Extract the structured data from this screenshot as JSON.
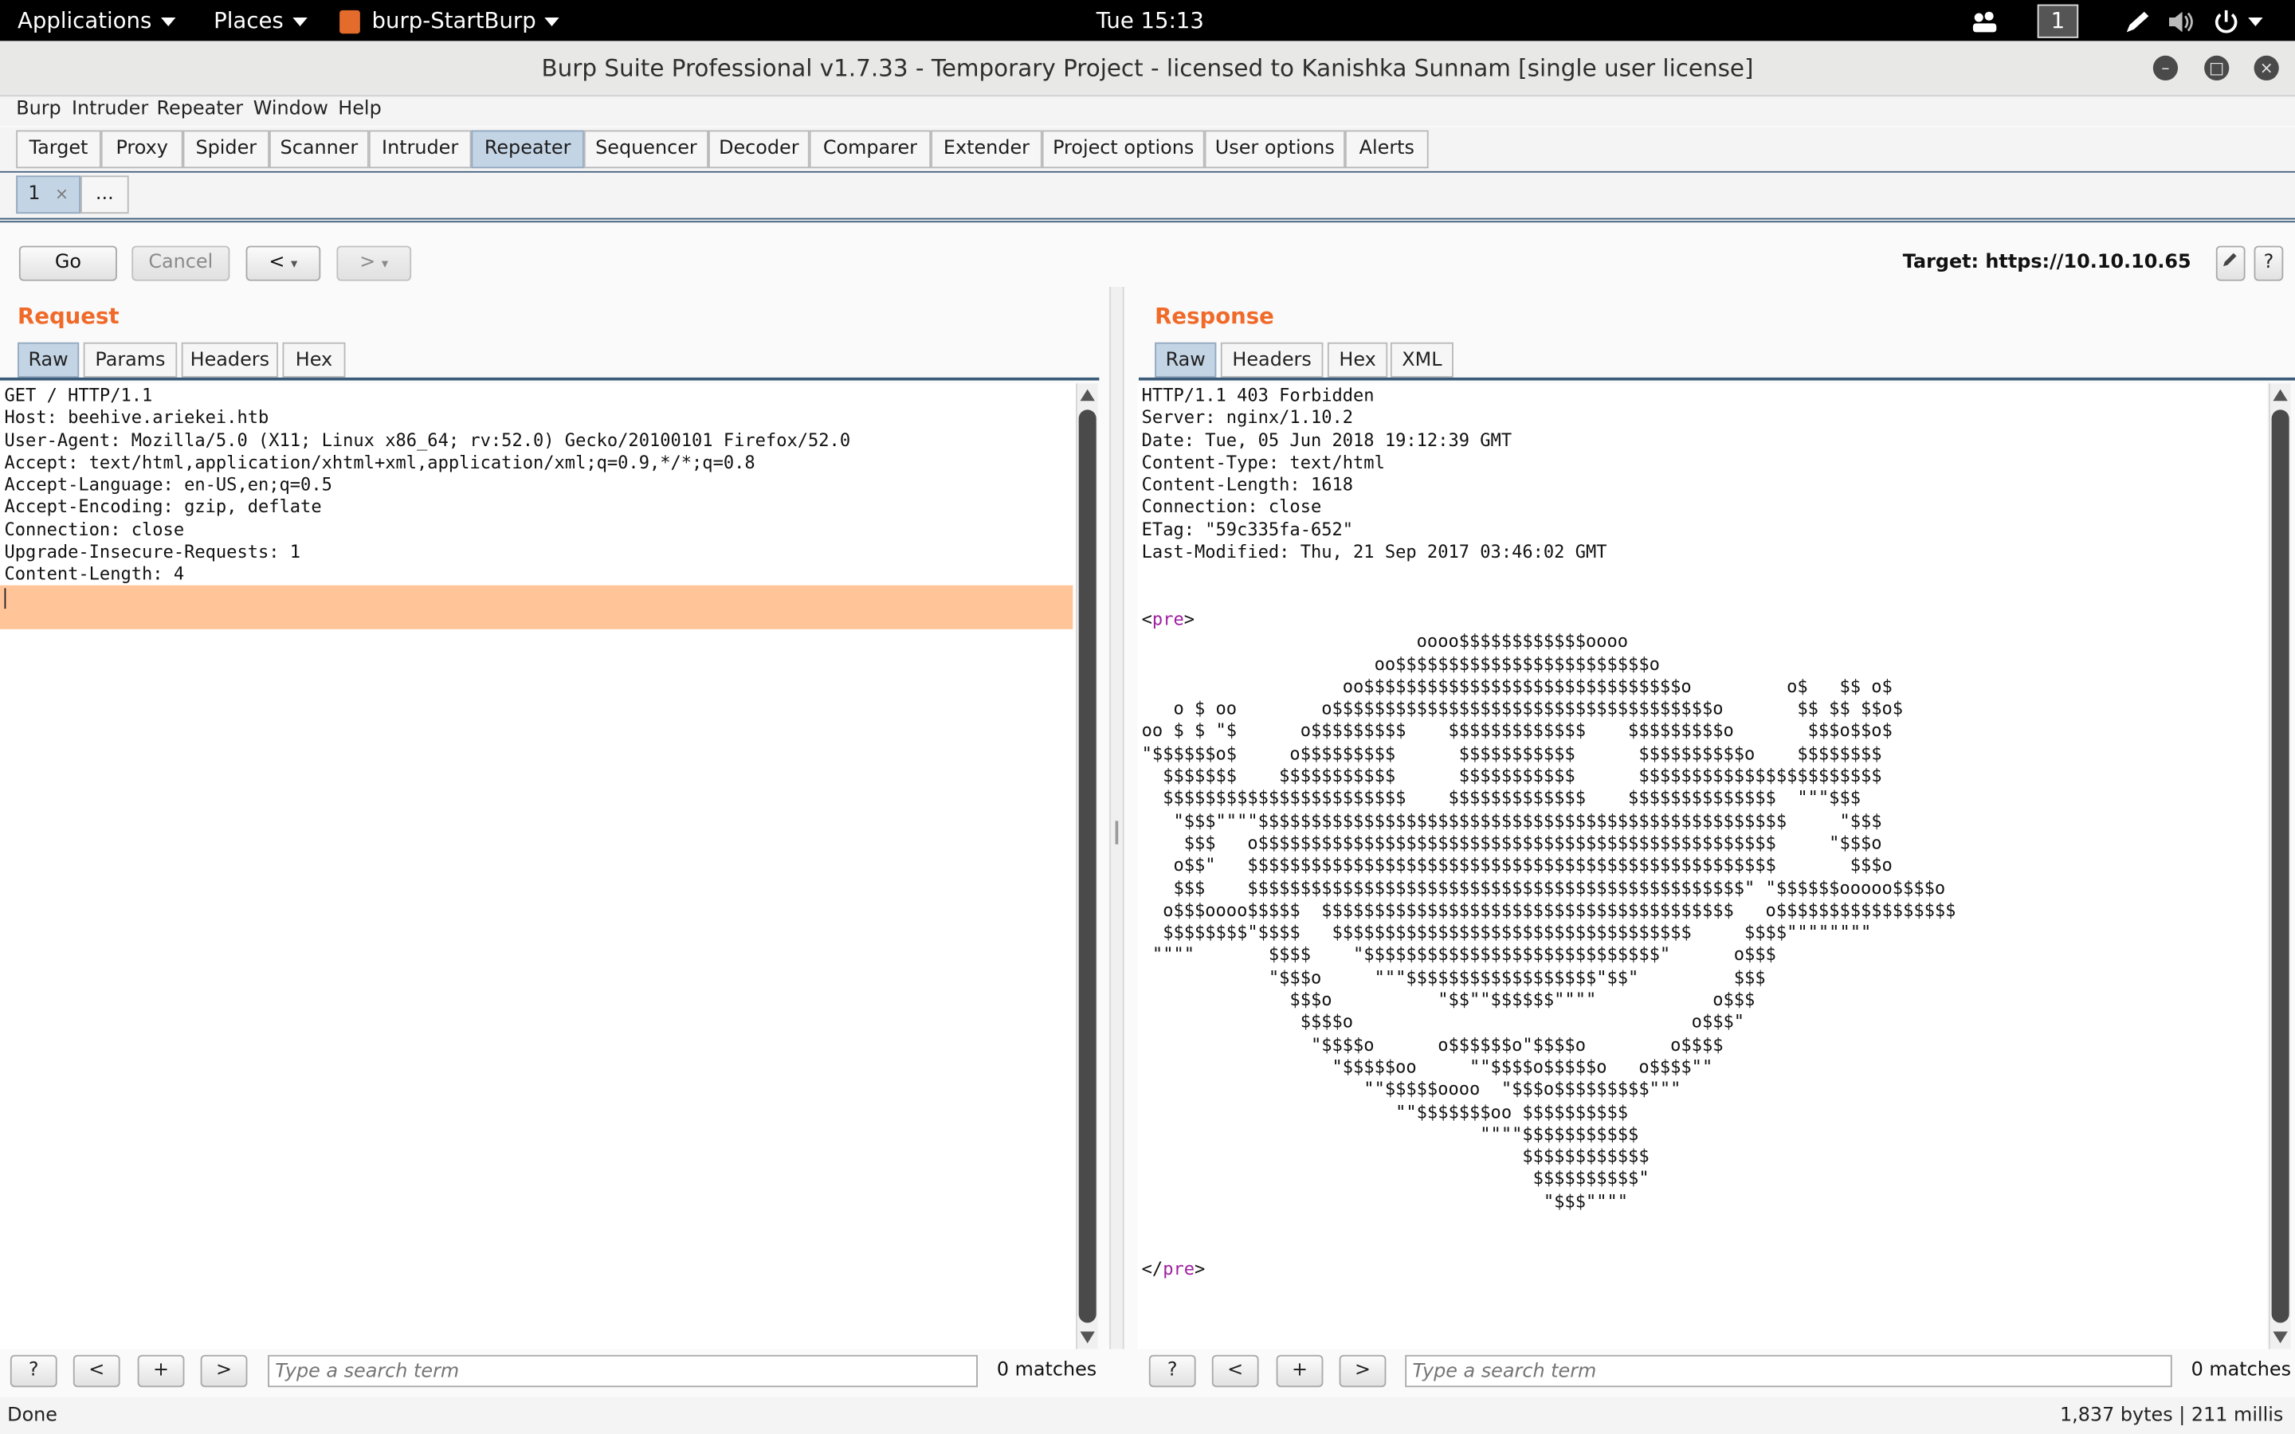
{
  "system_bar": {
    "applications": "Applications",
    "places": "Places",
    "app_name": "burp-StartBurp",
    "clock": "Tue 15:13",
    "workspace": "1"
  },
  "window": {
    "title": "Burp Suite Professional v1.7.33 - Temporary Project - licensed to Kanishka Sunnam [single user license]"
  },
  "menu": [
    "Burp",
    "Intruder",
    "Repeater",
    "Window",
    "Help"
  ],
  "main_tabs": [
    "Target",
    "Proxy",
    "Spider",
    "Scanner",
    "Intruder",
    "Repeater",
    "Sequencer",
    "Decoder",
    "Comparer",
    "Extender",
    "Project options",
    "User options",
    "Alerts"
  ],
  "active_main_tab": "Repeater",
  "repeater_tabs": {
    "tab1": "1",
    "tab1_close": "×",
    "more": "..."
  },
  "toolbar": {
    "go": "Go",
    "cancel": "Cancel",
    "back": "<",
    "forward": ">",
    "dropdown": "▾",
    "target_label": "Target: https://10.10.10.65",
    "help": "?"
  },
  "request": {
    "title": "Request",
    "tabs": [
      "Raw",
      "Params",
      "Headers",
      "Hex"
    ],
    "raw_text": "GET / HTTP/1.1\nHost: beehive.ariekei.htb\nUser-Agent: Mozilla/5.0 (X11; Linux x86_64; rv:52.0) Gecko/20100101 Firefox/52.0\nAccept: text/html,application/xhtml+xml,application/xml;q=0.9,*/*;q=0.8\nAccept-Language: en-US,en;q=0.5\nAccept-Encoding: gzip, deflate\nConnection: close\nUpgrade-Insecure-Requests: 1\nContent-Length: 4"
  },
  "response": {
    "title": "Response",
    "tabs": [
      "Raw",
      "Headers",
      "Hex",
      "XML"
    ],
    "headers_text": "HTTP/1.1 403 Forbidden\nServer: nginx/1.10.2\nDate: Tue, 05 Jun 2018 19:12:39 GMT\nContent-Type: text/html\nContent-Length: 1618\nConnection: close\nETag: \"59c335fa-652\"\nLast-Modified: Thu, 21 Sep 2017 03:46:02 GMT",
    "pre_open_lt": "<",
    "pre_tag": "pre",
    "pre_open_gt": ">",
    "ascii_art": "                          oooo$$$$$$$$$$$$oooo\n                      oo$$$$$$$$$$$$$$$$$$$$$$$$o\n                   oo$$$$$$$$$$$$$$$$$$$$$$$$$$$$$$o         o$   $$ o$\n   o $ oo        o$$$$$$$$$$$$$$$$$$$$$$$$$$$$$$$$$$$$o       $$ $$ $$o$\noo $ $ \"$      o$$$$$$$$$    $$$$$$$$$$$$$    $$$$$$$$$o       $$$o$$o$\n\"$$$$$$o$     o$$$$$$$$$      $$$$$$$$$$$      $$$$$$$$$$o    $$$$$$$$\n  $$$$$$$    $$$$$$$$$$$      $$$$$$$$$$$      $$$$$$$$$$$$$$$$$$$$$$$\n  $$$$$$$$$$$$$$$$$$$$$$$    $$$$$$$$$$$$$    $$$$$$$$$$$$$$  \"\"\"$$$\n   \"$$$\"\"\"\"$$$$$$$$$$$$$$$$$$$$$$$$$$$$$$$$$$$$$$$$$$$$$$$$$$     \"$$$\n    $$$   o$$$$$$$$$$$$$$$$$$$$$$$$$$$$$$$$$$$$$$$$$$$$$$$$$     \"$$$o\n   o$$\"   $$$$$$$$$$$$$$$$$$$$$$$$$$$$$$$$$$$$$$$$$$$$$$$$$$       $$$o\n   $$$    $$$$$$$$$$$$$$$$$$$$$$$$$$$$$$$$$$$$$$$$$$$$$$$\" \"$$$$$$ooooo$$$$o\n  o$$$oooo$$$$$  $$$$$$$$$$$$$$$$$$$$$$$$$$$$$$$$$$$$$$$   o$$$$$$$$$$$$$$$$$\n  $$$$$$$$\"$$$$   $$$$$$$$$$$$$$$$$$$$$$$$$$$$$$$$$$     $$$$\"\"\"\"\"\"\"\"\n \"\"\"\"       $$$$    \"$$$$$$$$$$$$$$$$$$$$$$$$$$$$\"      o$$$\n            \"$$$o     \"\"\"$$$$$$$$$$$$$$$$$$\"$$\"         $$$\n              $$$o          \"$$\"\"$$$$$$\"\"\"\"           o$$$\n               $$$$o                                o$$$\"\n                \"$$$$o      o$$$$$$o\"$$$$o        o$$$$\n                  \"$$$$$oo     \"\"$$$$o$$$$$o   o$$$$\"\"\n                     \"\"$$$$$oooo  \"$$$o$$$$$$$$$\"\"\"\n                        \"\"$$$$$$$oo $$$$$$$$$$\n                                \"\"\"\"$$$$$$$$$$$\n                                    $$$$$$$$$$$$\n                                     $$$$$$$$$$\"\n                                      \"$$$\"\"\"\"",
    "pre_close_lt": "</",
    "pre_close_tag": "pre",
    "pre_close_gt": ">"
  },
  "search": {
    "help": "?",
    "prev": "<",
    "add": "+",
    "next": ">",
    "placeholder": "Type a search term",
    "matches": "0 matches"
  },
  "status": {
    "left": "Done",
    "right": "1,837 bytes | 211 millis"
  }
}
